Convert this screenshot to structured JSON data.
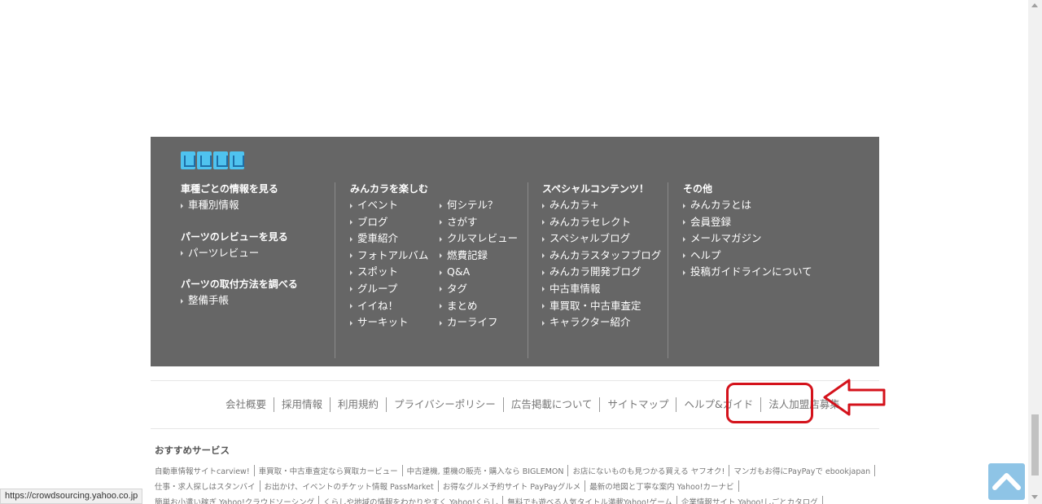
{
  "footer": {
    "col1": [
      {
        "heading": "車種ごとの情報を見る",
        "links": [
          "車種別情報"
        ]
      },
      {
        "heading": "パーツのレビューを見る",
        "links": [
          "パーツレビュー"
        ]
      },
      {
        "heading": "パーツの取付方法を調べる",
        "links": [
          "整備手帳"
        ]
      }
    ],
    "col2": {
      "heading": "みんカラを楽しむ",
      "left": [
        "イベント",
        "ブログ",
        "愛車紹介",
        "フォトアルバム",
        "スポット",
        "グループ",
        "イイね！",
        "サーキット"
      ],
      "right": [
        "何シテル？",
        "さがす",
        "クルマレビュー",
        "燃費記録",
        "Q&A",
        "タグ",
        "まとめ",
        "カーライフ"
      ]
    },
    "col3": {
      "heading": "スペシャルコンテンツ！",
      "links": [
        "みんカラ+",
        "みんカラセレクト",
        "スペシャルブログ",
        "みんカラスタッフブログ",
        "みんカラ開発ブログ",
        "中古車情報",
        "車買取・中古車査定",
        "キャラクター紹介"
      ]
    },
    "col4": {
      "heading": "その他",
      "links": [
        "みんカラとは",
        "会員登録",
        "メールマガジン",
        "ヘルプ",
        "投稿ガイドラインについて"
      ]
    }
  },
  "bottom_nav": [
    "会社概要",
    "採用情報",
    "利用規約",
    "プライバシーポリシー",
    "広告掲載について",
    "サイトマップ",
    "ヘルプ&ガイド",
    "法人加盟店募集"
  ],
  "recommend": {
    "title": "おすすめサービス",
    "row1": [
      "自動車情報サイトcarview!",
      "車買取・中古車査定なら買取カービュー",
      "中古建機, 重機の販売・購入なら BIGLEMON",
      "お店にないものも見つかる買える ヤフオク!",
      "マンガもお得にPayPayで ebookjapan"
    ],
    "row2": [
      "仕事・求人探しはスタンバイ",
      "お出かけ、イベントのチケット情報 PassMarket",
      "お得なグルメ予約サイト PayPayグルメ",
      "最新の地図と丁寧な案内 Yahoo!カーナビ"
    ],
    "row3": [
      "簡単お小遣い稼ぎ Yahoo!クラウドソーシング",
      "くらしや地域の情報をわかりやすく Yahoo!くらし",
      "無料でも遊べる人気タイトル満載Yahoo!ゲーム",
      "企業情報サイト Yahoo!しごとカタログ"
    ]
  },
  "status_url": "https://crowdsourcing.yahoo.co.jp",
  "colors": {
    "footer_bg": "#666666",
    "highlight": "#d4121b",
    "totop": "#8ec4e6"
  },
  "icons": {
    "scroll_top": "chevron-up-icon",
    "annotation": "arrow-left-icon"
  }
}
